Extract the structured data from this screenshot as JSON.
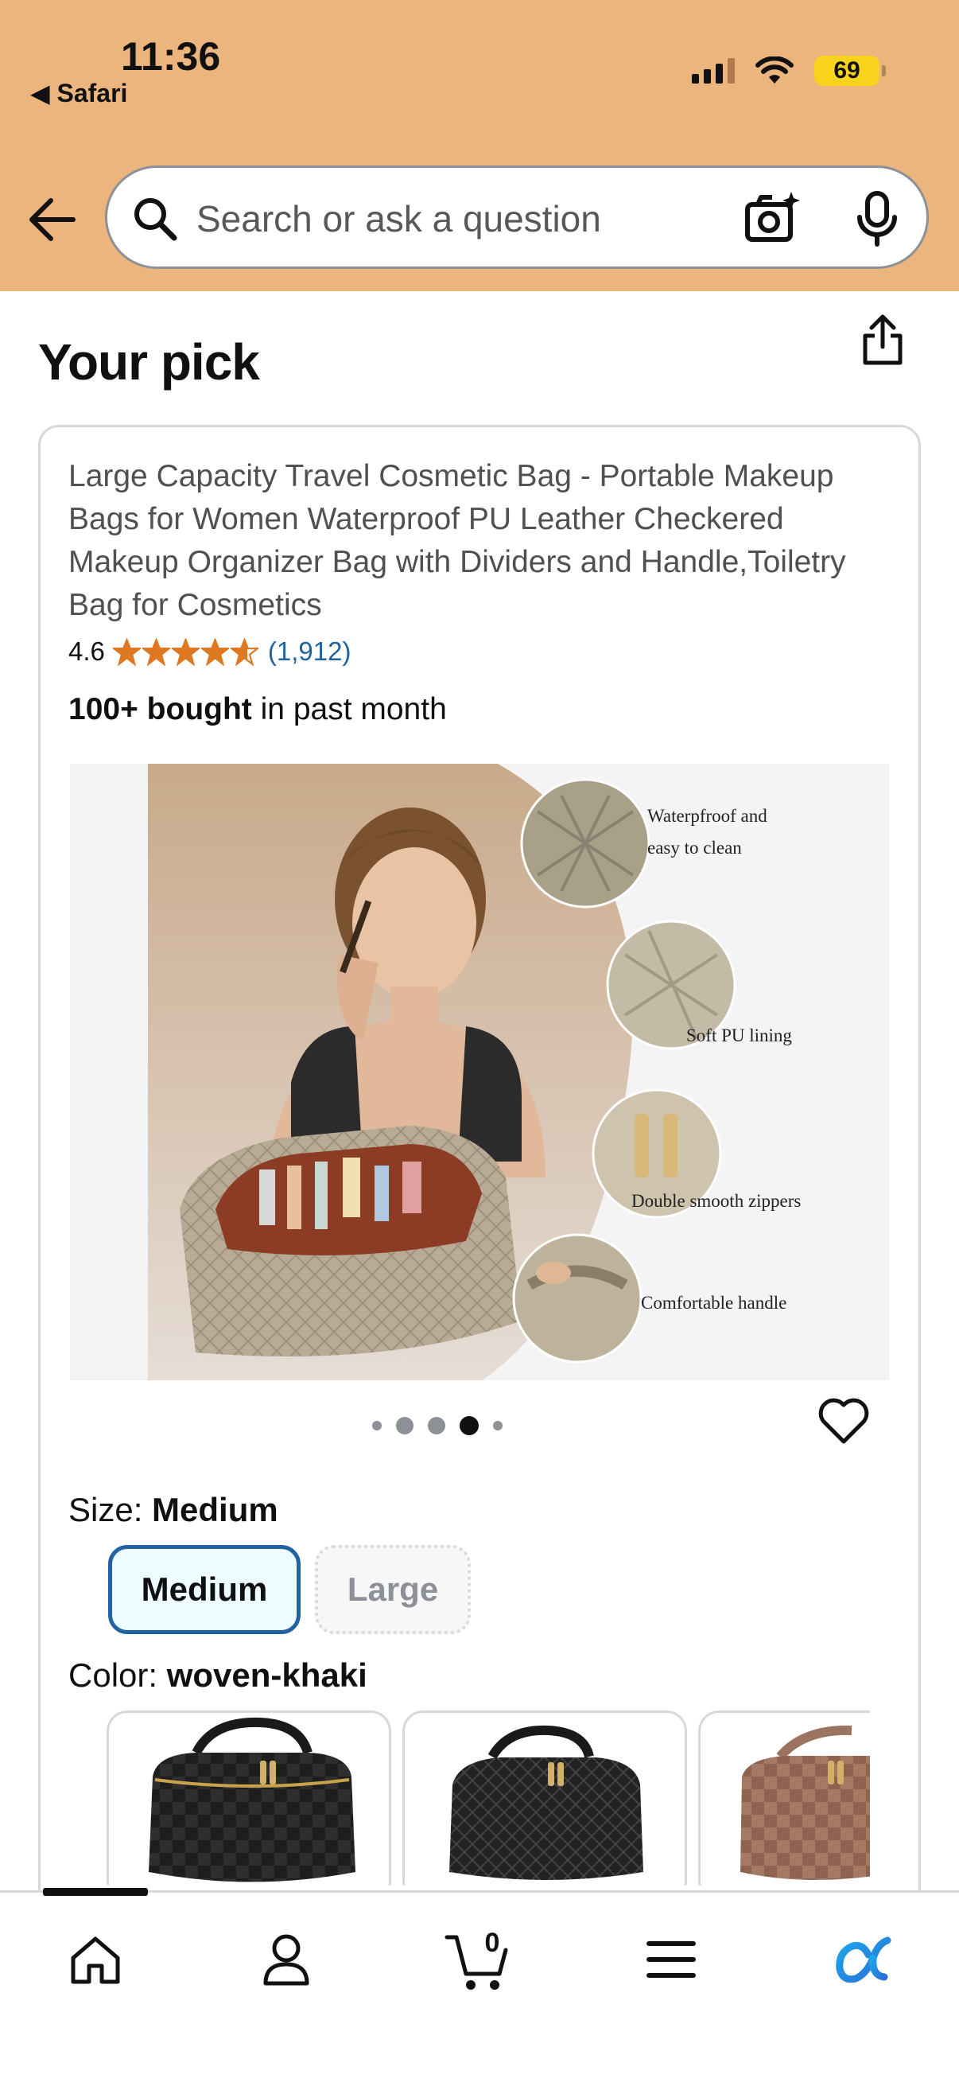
{
  "status_bar": {
    "time": "11:36",
    "back_app": "◀ Safari",
    "battery": "69"
  },
  "search": {
    "placeholder": "Search or ask a question"
  },
  "page": {
    "title": "Your pick"
  },
  "product": {
    "title": "Large Capacity Travel Cosmetic Bag - Portable Makeup Bags for Women Waterproof PU Leather Checkered Makeup Organizer Bag with Dividers and Handle,Toiletry Bag for Cosmetics",
    "rating": "4.6",
    "rating_stars": 4.6,
    "rating_count": "(1,912)",
    "bought_bold": "100+ bought",
    "bought_rest": " in past month",
    "image_features": [
      "Waterpfroof and",
      "easy to clean",
      "Soft PU lining",
      "Double smooth zippers",
      "Comfortable handle"
    ],
    "carousel_count": 5,
    "carousel_active": 3
  },
  "size": {
    "label": "Size: ",
    "selected": "Medium",
    "options": [
      "Medium",
      "Large"
    ]
  },
  "color": {
    "label": "Color: ",
    "selected": "woven-khaki"
  },
  "nav": {
    "cart_count": "0"
  },
  "colors": {
    "header_bg": "#edb57e",
    "star": "#de7921",
    "link": "#2162a1",
    "selected_border": "#2162a1"
  }
}
